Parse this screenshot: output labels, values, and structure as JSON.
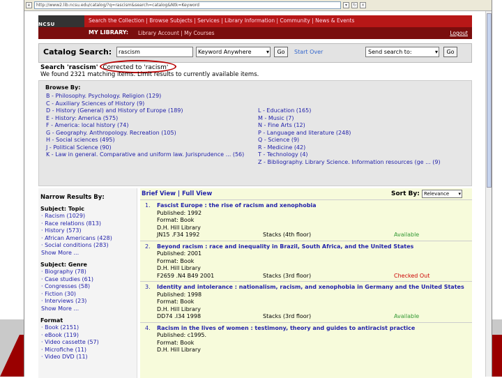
{
  "browser": {
    "url": "http://www2.lib.ncsu.edu/catalog/?q=rascism&search=catalog&Ntk=Keyword"
  },
  "header": {
    "logo": "NCSU LIBRARIES",
    "nav": "Search the Collection | Browse Subjects | Services | Library Information | Community | News & Events",
    "my_library": "MY LIBRARY:",
    "my_links": "Library Account  |  My Courses",
    "logout": "Logout"
  },
  "search": {
    "label": "Catalog Search:",
    "value": "rascism",
    "type": "Keyword Anywhere",
    "go": "Go",
    "start_over": "Start Over",
    "send_to": "Send search to:",
    "go2": "Go"
  },
  "correction": {
    "search_label": "Search 'rascism'",
    "corrected": "Corrected to 'racism'",
    "found": "We found 2321 matching items. Limit results to currently available items."
  },
  "browse": {
    "title": "Browse By:",
    "left": [
      "B - Philosophy. Psychology. Religion (129)",
      "C - Auxiliary Sciences of History (9)",
      "D - History (General) and History of Europe (189)",
      "E - History: America (575)",
      "F - America: local history (74)",
      "G - Geography. Anthropology. Recreation (105)",
      "H - Social sciences (495)",
      "J - Political Science (90)",
      "K - Law in general. Comparative and uniform law. Jurisprudence ... (56)"
    ],
    "right": [
      "L - Education (165)",
      "M - Music (7)",
      "N - Fine Arts (12)",
      "P - Language and literature (248)",
      "Q - Science (9)",
      "R - Medicine (42)",
      "T - Technology (4)",
      "Z - Bibliography. Library Science. Information resources (ge ... (9)"
    ]
  },
  "narrow": {
    "title": "Narrow Results By:",
    "groups": [
      {
        "name": "Subject: Topic",
        "items": [
          "Racism (1029)",
          "Race relations (813)",
          "History (573)",
          "African Americans (428)",
          "Social conditions (283)"
        ],
        "more": "Show More ..."
      },
      {
        "name": "Subject: Genre",
        "items": [
          "Biography (78)",
          "Case studies (61)",
          "Congresses (58)",
          "Fiction (30)",
          "Interviews (23)"
        ],
        "more": "Show More ..."
      },
      {
        "name": "Format",
        "items": [
          "Book (2151)",
          "eBook (119)",
          "Video cassette (57)",
          "Microfiche (11)",
          "Video DVD (11)"
        ],
        "more": ""
      }
    ]
  },
  "results": {
    "views": "Brief View | Full View",
    "sort_label": "Sort By:",
    "sort_value": "Relevance",
    "items": [
      {
        "n": "1.",
        "title": "Fascist Europe : the rise of racism and xenophobia",
        "published": "Published: 1992",
        "format": "Format: Book",
        "library": "D.H. Hill Library",
        "call": "JN15 .F34 1992",
        "loc": "Stacks (4th floor)",
        "status": "Available",
        "st": "avail"
      },
      {
        "n": "2.",
        "title": "Beyond racism : race and inequality in Brazil, South Africa, and the United States",
        "published": "Published: 2001",
        "format": "Format: Book",
        "library": "D.H. Hill Library",
        "call": "F2659 .N4 B49 2001",
        "loc": "Stacks (3rd floor)",
        "status": "Checked Out",
        "st": "out"
      },
      {
        "n": "3.",
        "title": "Identity and intolerance : nationalism, racism, and xenophobia in Germany and the United States",
        "published": "Published: 1998",
        "format": "Format: Book",
        "library": "D.H. Hill Library",
        "call": "DD74 .I34 1998",
        "loc": "Stacks (3rd floor)",
        "status": "Available",
        "st": "avail"
      },
      {
        "n": "4.",
        "title": "Racism in the lives of women : testimony, theory and guides to antiracist practice",
        "published": "Published: c1995.",
        "format": "Format: Book",
        "library": "D.H. Hill Library",
        "call": "",
        "loc": "",
        "status": "",
        "st": ""
      }
    ]
  }
}
